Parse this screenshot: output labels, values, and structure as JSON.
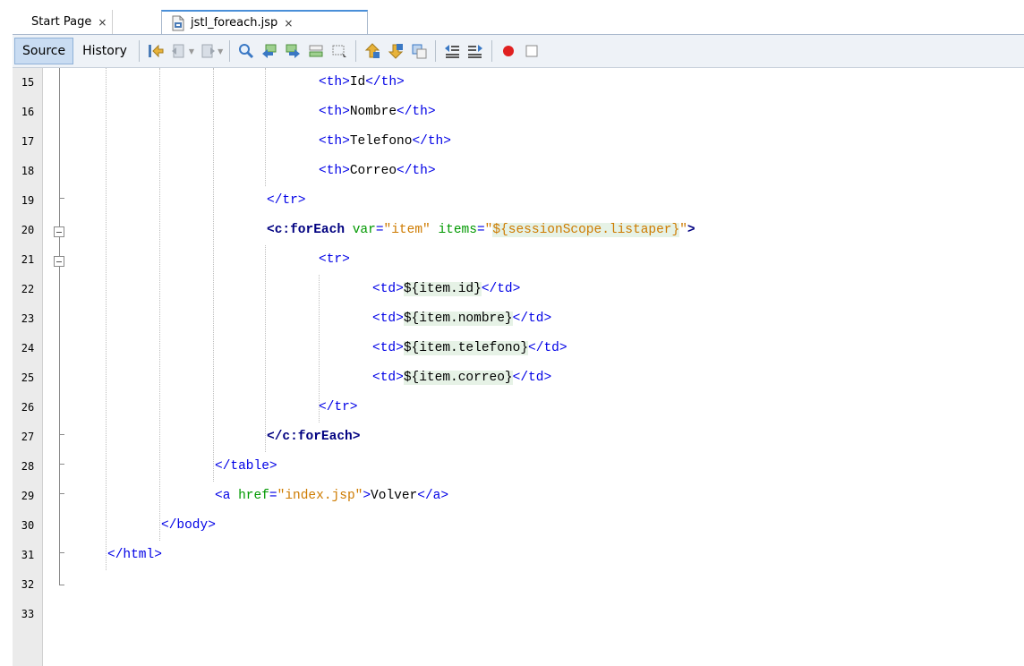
{
  "tabs": [
    {
      "label": "Start Page",
      "close": "×"
    },
    {
      "label": "jstl_foreach.jsp",
      "close": "×"
    }
  ],
  "toolbar": {
    "source_label": "Source",
    "history_label": "History"
  },
  "editor": {
    "line_numbers": [
      "15",
      "16",
      "17",
      "18",
      "19",
      "20",
      "21",
      "22",
      "23",
      "24",
      "25",
      "26",
      "27",
      "28",
      "29",
      "30",
      "31",
      "32",
      "33"
    ],
    "lines": {
      "l15": {
        "open": "<th>",
        "text": "Id",
        "close": "</th>"
      },
      "l16": {
        "open": "<th>",
        "text": "Nombre",
        "close": "</th>"
      },
      "l17": {
        "open": "<th>",
        "text": "Telefono",
        "close": "</th>"
      },
      "l18": {
        "open": "<th>",
        "text": "Correo",
        "close": "</th>"
      },
      "l19": {
        "close": "</tr>"
      },
      "l20": {
        "open": "<c:forEach",
        "attr1": "var",
        "eq1": "=",
        "val1": "\"item\"",
        "attr2": "items",
        "eq2": "=",
        "q1": "\"",
        "el": "${sessionScope.listaper}",
        "q2": "\"",
        "end": ">"
      },
      "l21": {
        "open": "<tr>"
      },
      "l22": {
        "open": "<td>",
        "el": "${item.id}",
        "close": "</td>"
      },
      "l23": {
        "open": "<td>",
        "el": "${item.nombre}",
        "close": "</td>"
      },
      "l24": {
        "open": "<td>",
        "el": "${item.telefono}",
        "close": "</td>"
      },
      "l25": {
        "open": "<td>",
        "el": "${item.correo}",
        "close": "</td>"
      },
      "l26": {
        "close": "</tr>"
      },
      "l27": {
        "close": "</c:forEach>"
      },
      "l28": {
        "close": "</table>"
      },
      "l29": {
        "open": "<a",
        "attr1": "href",
        "eq1": "=",
        "val1": "\"index.jsp\"",
        "end": ">",
        "text": "Volver",
        "close": "</a>"
      },
      "l30": {
        "close": "</body>"
      },
      "l31": {
        "close": "</html>"
      }
    }
  },
  "colors": {
    "tag": "#0000e6",
    "custom_tag": "#000080",
    "attribute": "#009900",
    "value": "#ce7b00",
    "el_highlight": "#e6f2e6",
    "active_tab_border": "#4a8fd8"
  }
}
